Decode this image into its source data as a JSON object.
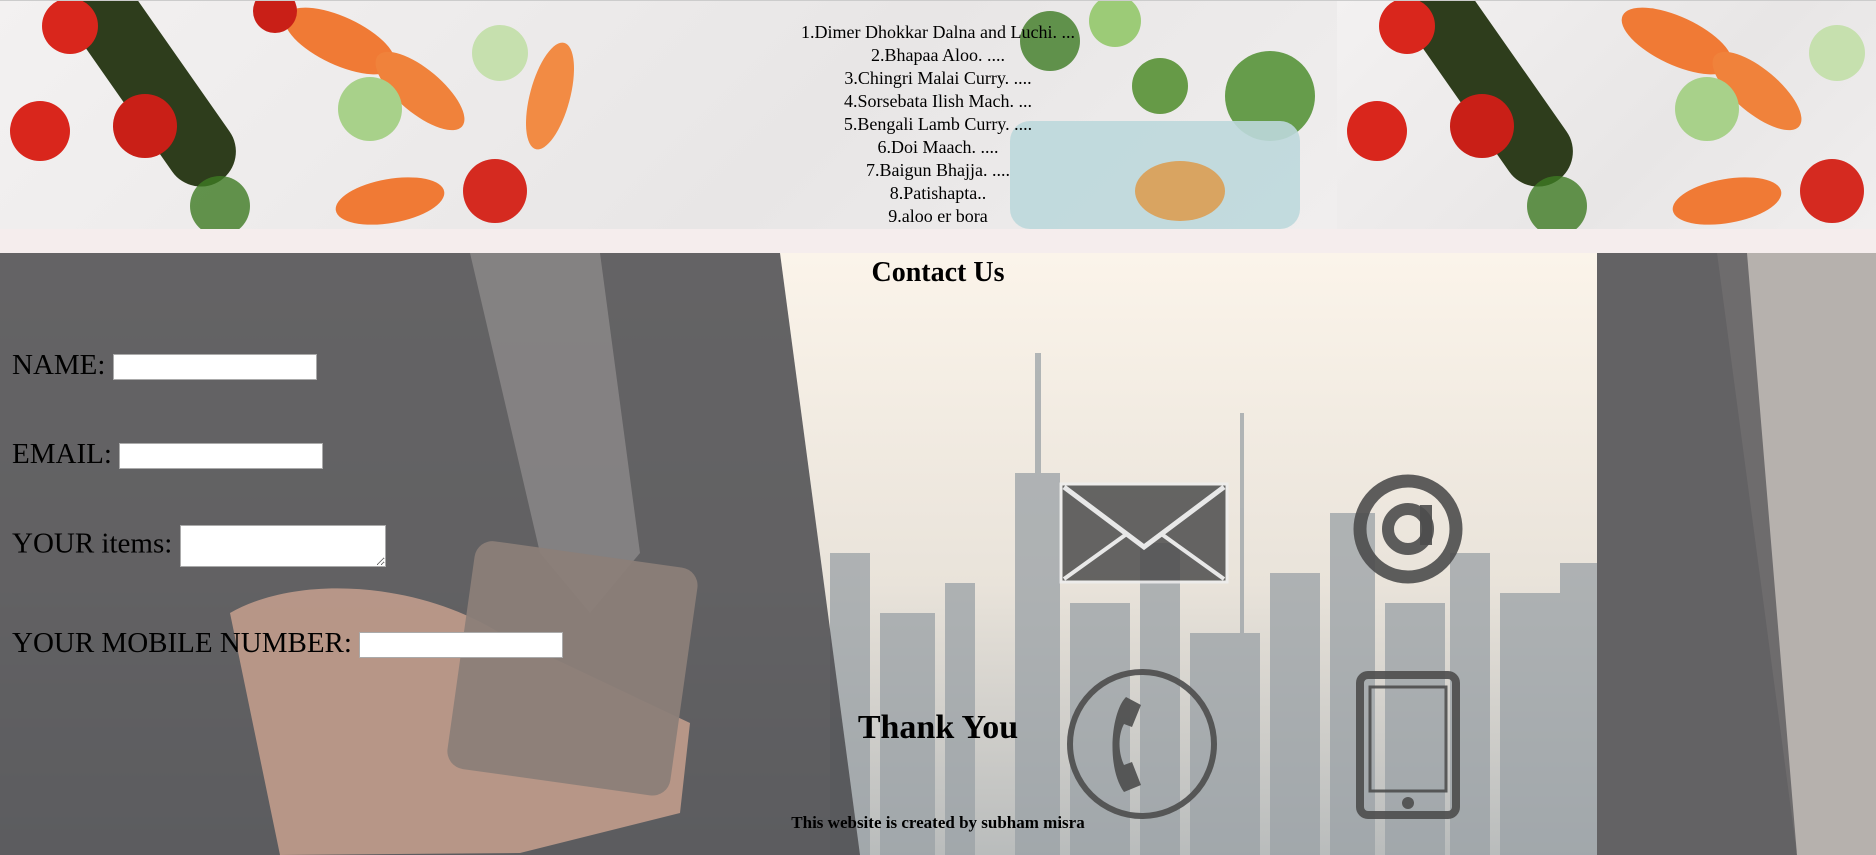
{
  "dishes": [
    "1.Dimer Dhokkar Dalna and Luchi. ...",
    "2.Bhapaa Aloo. ....",
    "3.Chingri Malai Curry. ....",
    "4.Sorsebata Ilish Mach. ...",
    "5.Bengali Lamb Curry. ....",
    "6.Doi Maach. ....",
    "7.Baigun Bhajja. ....",
    "8.Patishapta..",
    "9.aloo er bora"
  ],
  "contact": {
    "title": "Contact Us",
    "name_label": "NAME:",
    "email_label": "EMAIL:",
    "items_label": "YOUR items:",
    "mobile_label": "YOUR MOBILE NUMBER:",
    "name_value": "",
    "email_value": "",
    "items_value": "",
    "mobile_value": ""
  },
  "thank_you": "Thank You",
  "credit": "This website is created by subham misra",
  "icons": [
    "envelope-icon",
    "at-sign-icon",
    "phone-icon",
    "tablet-icon"
  ]
}
